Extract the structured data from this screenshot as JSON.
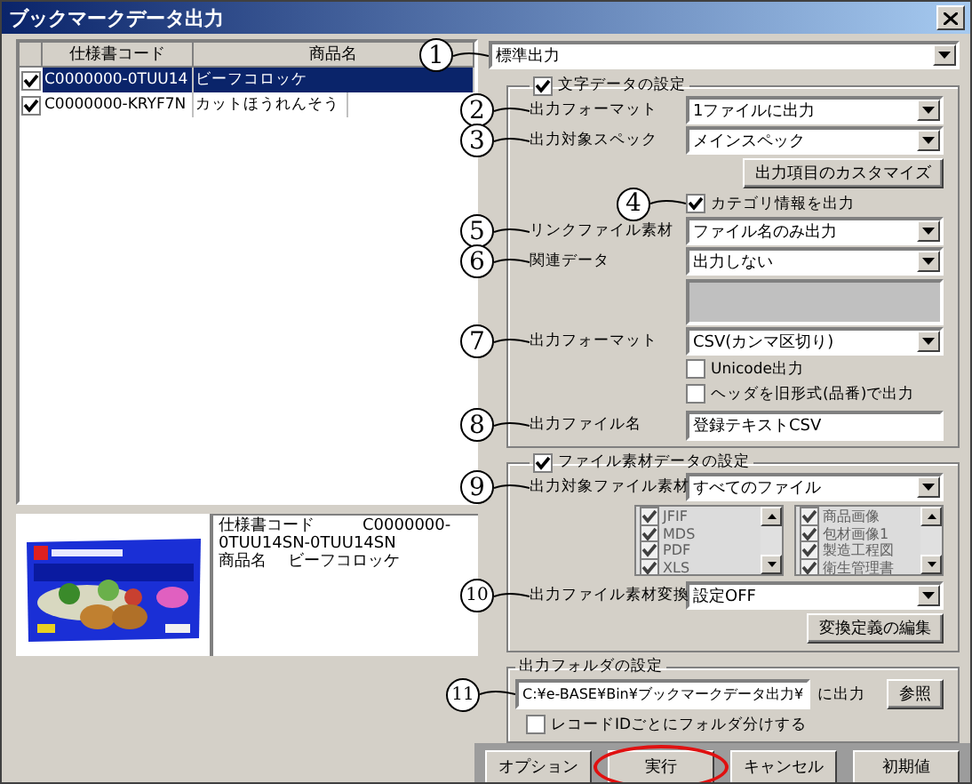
{
  "window": {
    "title": "ブックマークデータ出力"
  },
  "table": {
    "columns": [
      "仕様書コード",
      "商品名"
    ],
    "rows": [
      {
        "checked": true,
        "selected": true,
        "code": "C0000000-0TUU14",
        "name": "ビーフコロッケ"
      },
      {
        "checked": true,
        "selected": false,
        "code": "C0000000-KRYF7N",
        "name": "カットほうれんそう"
      }
    ]
  },
  "preview": {
    "picture": {
      "kind": "picture"
    },
    "info": [
      "仕様書コード　　　C0000000-",
      "0TUU14SN-0TUU14SN",
      "商品名　 ビーフコロッケ"
    ]
  },
  "output_mode": {
    "value": "標準出力",
    "callout": "1"
  },
  "text_data": {
    "title": "文字データの設定",
    "checked": true,
    "rows": [
      {
        "kind": "select",
        "label": "出力フォーマット",
        "value": "1ファイルに出力",
        "callout": "2"
      },
      {
        "kind": "select",
        "label": "出力対象スペック",
        "value": "メインスペック",
        "callout": "3"
      },
      {
        "kind": "button",
        "label": "出力項目のカスタマイズ"
      },
      {
        "kind": "checkbox",
        "label": "カテゴリ情報を出力",
        "checked": true,
        "callout": "4"
      },
      {
        "kind": "select",
        "label": "リンクファイル素材",
        "value": "ファイル名のみ出力",
        "callout": "5"
      },
      {
        "kind": "select",
        "label": "関連データ",
        "value": "出力しない",
        "callout": "6"
      },
      {
        "kind": "blank",
        "disabled": true
      },
      {
        "kind": "select",
        "label": "出力フォーマット",
        "value": "CSV(カンマ区切り)",
        "callout": "7"
      },
      {
        "kind": "checkbox",
        "label": "Unicode出力",
        "checked": false
      },
      {
        "kind": "checkbox",
        "label": "ヘッダを旧形式(品番)で出力",
        "checked": false
      },
      {
        "kind": "input",
        "label": "出力ファイル名",
        "value": "登録テキストCSV",
        "callout": "8"
      }
    ]
  },
  "file_data": {
    "title": "ファイル素材データの設定",
    "checked": true,
    "rows": [
      {
        "kind": "select",
        "label": "出力対象ファイル素材",
        "value": "すべてのファイル",
        "callout": "9"
      },
      {
        "kind": "lists",
        "disabled": true,
        "lists": [
          {
            "items": [
              {
                "label": "JFIF",
                "checked": true
              },
              {
                "label": "MDS",
                "checked": true
              },
              {
                "label": "PDF",
                "checked": true
              },
              {
                "label": "XLS",
                "checked": true
              }
            ]
          },
          {
            "items": [
              {
                "label": "商品画像",
                "checked": true
              },
              {
                "label": "包材画像1",
                "checked": true
              },
              {
                "label": "製造工程図",
                "checked": true
              },
              {
                "label": "衛生管理書",
                "checked": true
              }
            ]
          }
        ]
      },
      {
        "kind": "select",
        "label": "出力ファイル素材変換",
        "value": "設定OFF",
        "callout": "10"
      },
      {
        "kind": "button",
        "label": "変換定義の編集"
      }
    ]
  },
  "folder": {
    "title": "出力フォルダの設定",
    "path": "C:¥e-BASE¥Bin¥ブックマークデータ出力¥",
    "suffix": "に出力",
    "browse": "参照",
    "callout": "11",
    "split": {
      "label": "レコードIDごとにフォルダ分けする",
      "checked": false
    }
  },
  "buttons": [
    {
      "label": "オプション",
      "circled": false
    },
    {
      "label": "実行",
      "circled": true
    },
    {
      "label": "キャンセル",
      "circled": false
    },
    {
      "label": "初期値",
      "circled": false
    }
  ]
}
